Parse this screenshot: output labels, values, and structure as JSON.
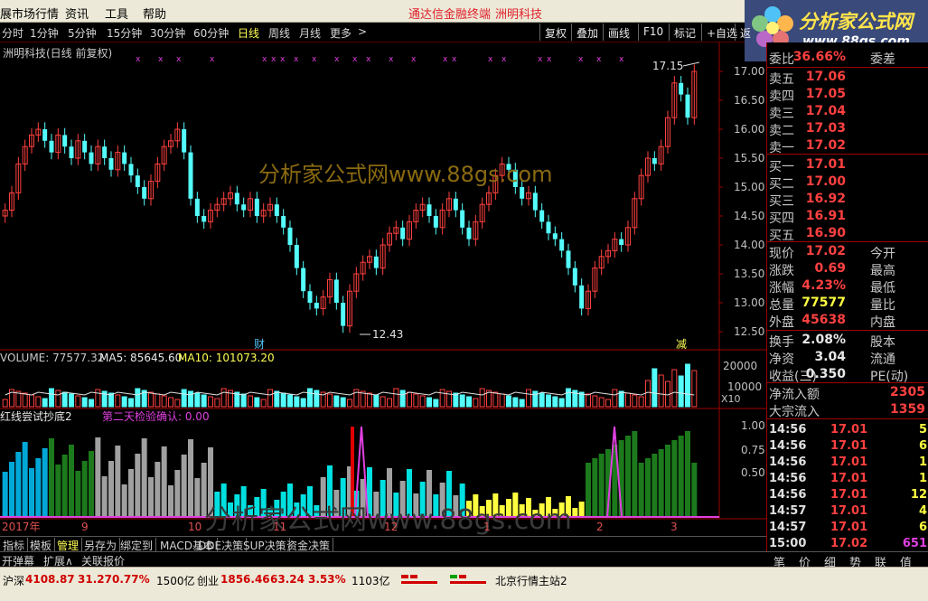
{
  "menu": {
    "items": [
      "展市场行情",
      "资讯",
      "工具",
      "帮助"
    ],
    "link1": "通达信金融终端",
    "link2": "洲明科技"
  },
  "logo": {
    "title": "分析家公式网",
    "url": "www.88gs.com"
  },
  "toolbar": {
    "periods": [
      "分时",
      "1分钟",
      "5分钟",
      "15分钟",
      "30分钟",
      "60分钟",
      "日线",
      "周线",
      "月线",
      "更多"
    ],
    "buttons": [
      "复权",
      "叠加",
      "画线",
      "F10",
      "标记",
      "+自选",
      "返"
    ]
  },
  "chart": {
    "title": "洲明科技(日线 前复权)",
    "watermark": "分析家公式网www.88gs.com",
    "marks": {
      "high": "17.15",
      "low": "12.43",
      "cai": "财",
      "jian": "减"
    },
    "volume": {
      "label": "VOLUME: 77577.32",
      "ma5": "MA5: 85645.60",
      "ma10": "MA10: 101073.20",
      "unit": "X10"
    },
    "indicator": {
      "name": "红线尝试抄底2",
      "signal": "第二天检验确认: 0.00"
    },
    "dates": [
      "2017年",
      "9",
      "10",
      "11",
      "12",
      "1",
      "2",
      "3"
    ]
  },
  "chart_data": {
    "type": "candlestick",
    "price_axis": [
      "17.00",
      "16.50",
      "16.00",
      "15.50",
      "15.00",
      "14.50",
      "14.00",
      "13.50",
      "13.00",
      "12.50"
    ],
    "vol_axis": [
      "20000",
      "10000"
    ],
    "ind_axis": [
      "1.00",
      "0.75",
      "0.50"
    ],
    "high": 17.15,
    "low": 12.43
  },
  "quote": {
    "ratio": {
      "label": "委比",
      "value": "36.66%",
      "label2": "委差"
    },
    "asks": [
      {
        "label": "卖五",
        "price": "17.06"
      },
      {
        "label": "卖四",
        "price": "17.05"
      },
      {
        "label": "卖三",
        "price": "17.04"
      },
      {
        "label": "卖二",
        "price": "17.03"
      },
      {
        "label": "卖一",
        "price": "17.02"
      }
    ],
    "bids": [
      {
        "label": "买一",
        "price": "17.01"
      },
      {
        "label": "买二",
        "price": "17.00"
      },
      {
        "label": "买三",
        "price": "16.92"
      },
      {
        "label": "买四",
        "price": "16.91"
      },
      {
        "label": "买五",
        "price": "16.90"
      }
    ],
    "stats": [
      {
        "label": "现价",
        "value": "17.02",
        "label2": "今开"
      },
      {
        "label": "涨跌",
        "value": "0.69",
        "label2": "最高"
      },
      {
        "label": "涨幅",
        "value": "4.23%",
        "label2": "最低"
      },
      {
        "label": "总量",
        "value": "77577",
        "label2": "量比"
      },
      {
        "label": "外盘",
        "value": "45638",
        "label2": "内盘"
      }
    ],
    "fund": [
      {
        "label": "换手",
        "value": "2.08%",
        "label2": "股本"
      },
      {
        "label": "净资",
        "value": "3.04",
        "label2": "流通"
      },
      {
        "label": "收益(三)",
        "value": "0.350",
        "label2": "PE(动)"
      }
    ],
    "flow": [
      {
        "label": "净流入额",
        "value": "2305"
      },
      {
        "label": "大宗流入",
        "value": "1359"
      }
    ],
    "ticks": [
      {
        "t": "14:56",
        "p": "17.01",
        "v": "5"
      },
      {
        "t": "14:56",
        "p": "17.01",
        "v": "6"
      },
      {
        "t": "14:56",
        "p": "17.01",
        "v": "1"
      },
      {
        "t": "14:56",
        "p": "17.01",
        "v": "1"
      },
      {
        "t": "14:56",
        "p": "17.01",
        "v": "12"
      },
      {
        "t": "14:57",
        "p": "17.01",
        "v": "4"
      },
      {
        "t": "14:57",
        "p": "17.01",
        "v": "6"
      },
      {
        "t": "15:00",
        "p": "17.02",
        "v": "651"
      }
    ]
  },
  "tabs": [
    "指标",
    "模板",
    "管理",
    "另存为",
    "绑定到",
    "MACD基本",
    "DDE决策",
    "SUP决策",
    "资金决策"
  ],
  "subtabs": [
    "开弹幕",
    "扩展∧",
    "关联报价"
  ],
  "rtabs": [
    "笔",
    "价",
    "细",
    "势",
    "联",
    "值"
  ],
  "status": {
    "sh_label": "沪深",
    "sh": "4108.87",
    "sh_chg": "31.27",
    "sh_pct": "0.77%",
    "sh_amt": "1500亿",
    "cy_label": "创业",
    "cy": "1856.46",
    "cy_chg": "63.24",
    "cy_pct": "3.53%",
    "cy_amt": "1103亿",
    "server": "北京行情主站2"
  }
}
